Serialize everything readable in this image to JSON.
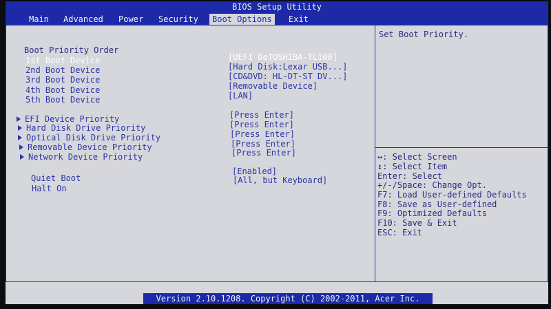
{
  "title": "BIOS Setup Utility",
  "menu": [
    {
      "label": "Main"
    },
    {
      "label": "Advanced"
    },
    {
      "label": "Power"
    },
    {
      "label": "Security"
    },
    {
      "label": "Boot Options"
    },
    {
      "label": "Exit"
    }
  ],
  "active_menu": "Boot Options",
  "boot_priority_order_heading": "Boot Priority Order",
  "boot_devices": [
    {
      "label": "1st Boot Device",
      "value": "[UEFI DeTOSHIBA-TL100]"
    },
    {
      "label": "2nd Boot Device",
      "value": "[Hard Disk:Lexar USB...]"
    },
    {
      "label": "3rd Boot Device",
      "value": "[CD&DVD: HL-DT-ST DV...]"
    },
    {
      "label": "4th Boot Device",
      "value": "[Removable Device]"
    },
    {
      "label": "5th Boot Device",
      "value": "[LAN]"
    }
  ],
  "priorities": [
    {
      "label": "EFI Device Priority",
      "value": "[Press Enter]"
    },
    {
      "label": "Hard Disk Drive Priority",
      "value": "[Press Enter]"
    },
    {
      "label": "Optical Disk Drive Priority",
      "value": "[Press Enter]"
    },
    {
      "label": "Removable Device Priority",
      "value": "[Press Enter]"
    },
    {
      "label": "Network Device Priority",
      "value": "[Press Enter]"
    }
  ],
  "options": [
    {
      "label": "Quiet Boot",
      "value": "[Enabled]"
    },
    {
      "label": "Halt On",
      "value": "[All, but Keyboard]"
    }
  ],
  "help": "Set Boot Priority.",
  "keys": [
    "↔: Select Screen",
    "↕: Select Item",
    "Enter: Select",
    "+/-/Space: Change Opt.",
    "F7: Load User-defined Defaults",
    "F8: Save as User-defined",
    "F9: Optimized Defaults",
    "F10: Save & Exit",
    "ESC: Exit"
  ],
  "footer": "Version 2.10.1208. Copyright (C) 2002-2011, Acer Inc.",
  "colors": {
    "bar_blue": "#1c29a8",
    "panel_gray": "#d6d7dc",
    "text_blue": "#2c35a8",
    "selected_text": "#ffffff"
  }
}
